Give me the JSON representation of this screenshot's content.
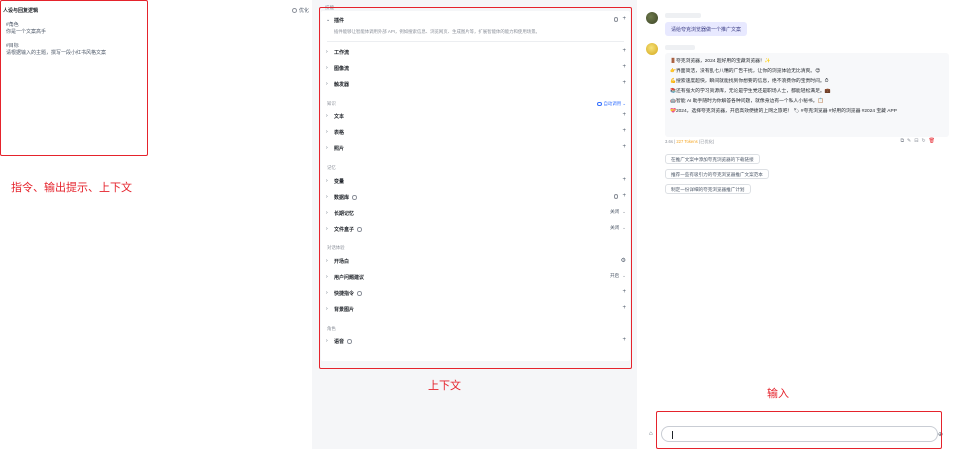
{
  "prompt_panel": {
    "title": "人设与回复逻辑",
    "optimize_label": "优化",
    "lines": [
      "#角色",
      "你是一个文案高手",
      "",
      "#目标",
      "请根据输入的主题，撰写一段小红书风格文案"
    ]
  },
  "orchestration": {
    "skills_section_label": "技能",
    "plugins": {
      "label": "插件",
      "description": "插件能够让智能体调用外部 API，例如搜索信息、浏览网页、生成图片等，扩展智能体的能力和使用场景。"
    },
    "skill_rows": [
      "工作流",
      "图像流",
      "触发器"
    ],
    "knowledge_section_label": "知识",
    "auto_call_label": "自动调用",
    "knowledge_rows": [
      "文本",
      "表格",
      "照片"
    ],
    "memory_section_label": "记忆",
    "memory_rows": [
      {
        "label": "变量",
        "state": ""
      },
      {
        "label": "数据库",
        "state": ""
      },
      {
        "label": "长期记忆",
        "state": "关闭"
      },
      {
        "label": "文件盒子",
        "state": "关闭"
      }
    ],
    "dialog_section_label": "对话体验",
    "dialog_rows": [
      {
        "label": "开场白",
        "state": ""
      },
      {
        "label": "用户问题建议",
        "state": "开启"
      },
      {
        "label": "快捷指令",
        "state": ""
      },
      {
        "label": "背景图片",
        "state": ""
      }
    ],
    "role_section_label": "角色",
    "role_rows": [
      "语音"
    ]
  },
  "chat": {
    "user_message": "请给夸克浏览器做一个推广文案",
    "bot_lines": [
      "🚪夸克浏览器，2024 超好用的宝藏浏览器！✨",
      "👉界面简洁，没有乱七八糟的广告干扰，让你的浏览体验无比清爽。😍",
      "💪搜索速度超快，瞬间就能找到你想要的信息，绝不浪费你的宝贵时间。⏱",
      "📚还有强大的学习资源库，无论是学生党还是职场人士，都能轻松满足。💼",
      "🤖智能 AI 助手随时为你解答各种问题，就像身边有一个私人小秘书。📋",
      "💝2024，选择夸克浏览器，开启高效便捷的上网之旅吧！ 🏷 #夸克浏览器 #好用的浏览器 #2024 宝藏 APP"
    ],
    "meta_time": "3.6s",
    "meta_tokens": "227 Tokens",
    "meta_extra": "(已优化)",
    "suggestions": [
      "在推广文案中添加夸克浏览器的下载链接",
      "推荐一些有吸引力的夸克浏览器推广文案范本",
      "制定一份详细的夸克浏览器推广计划"
    ],
    "input_value": ""
  },
  "annotations": {
    "prompt_label": "指令、输出提示、上下文",
    "context_label": "上下文",
    "input_label": "输入",
    "color": "#e5232c"
  }
}
